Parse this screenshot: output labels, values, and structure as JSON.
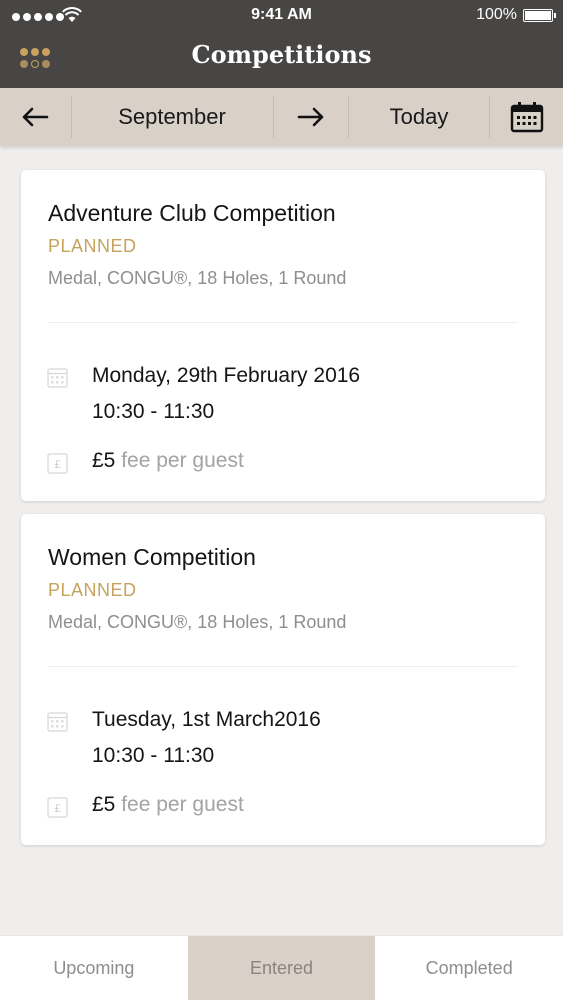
{
  "status_bar": {
    "time": "9:41 AM",
    "battery": "100%",
    "icons": [
      "signal-dots-icon",
      "wifi-icon",
      "battery-icon"
    ]
  },
  "header": {
    "title": "Competitions",
    "menu_icon": "grid-dots-icon",
    "colors": {
      "background": "#474644",
      "menu_dot_gold": "#c9a25d",
      "menu_dot_tan": "#a88b60"
    }
  },
  "month_nav": {
    "prev_icon": "arrow-left-icon",
    "month": "September",
    "next_icon": "arrow-right-icon",
    "today_label": "Today",
    "calendar_icon": "calendar-icon",
    "background": "#d9d0c8"
  },
  "competitions": [
    {
      "title": "Adventure Club Competition",
      "status": "PLANNED",
      "meta": "Medal, CONGU®, 18 Holes, 1 Round",
      "date": "Monday, 29th February 2016",
      "time": "10:30 - 11:30",
      "fee_amount": "£5",
      "fee_text": "fee per guest"
    },
    {
      "title": "Women Competition",
      "status": "PLANNED",
      "meta": "Medal, CONGU®, 18 Holes, 1 Round",
      "date": "Tuesday, 1st March2016",
      "time": "10:30 - 11:30",
      "fee_amount": "£5",
      "fee_text": "fee per guest"
    }
  ],
  "tabs": [
    {
      "label": "Upcoming",
      "active": false
    },
    {
      "label": "Entered",
      "active": true
    },
    {
      "label": "Completed",
      "active": false
    }
  ],
  "accent_color": "#c5a35b"
}
